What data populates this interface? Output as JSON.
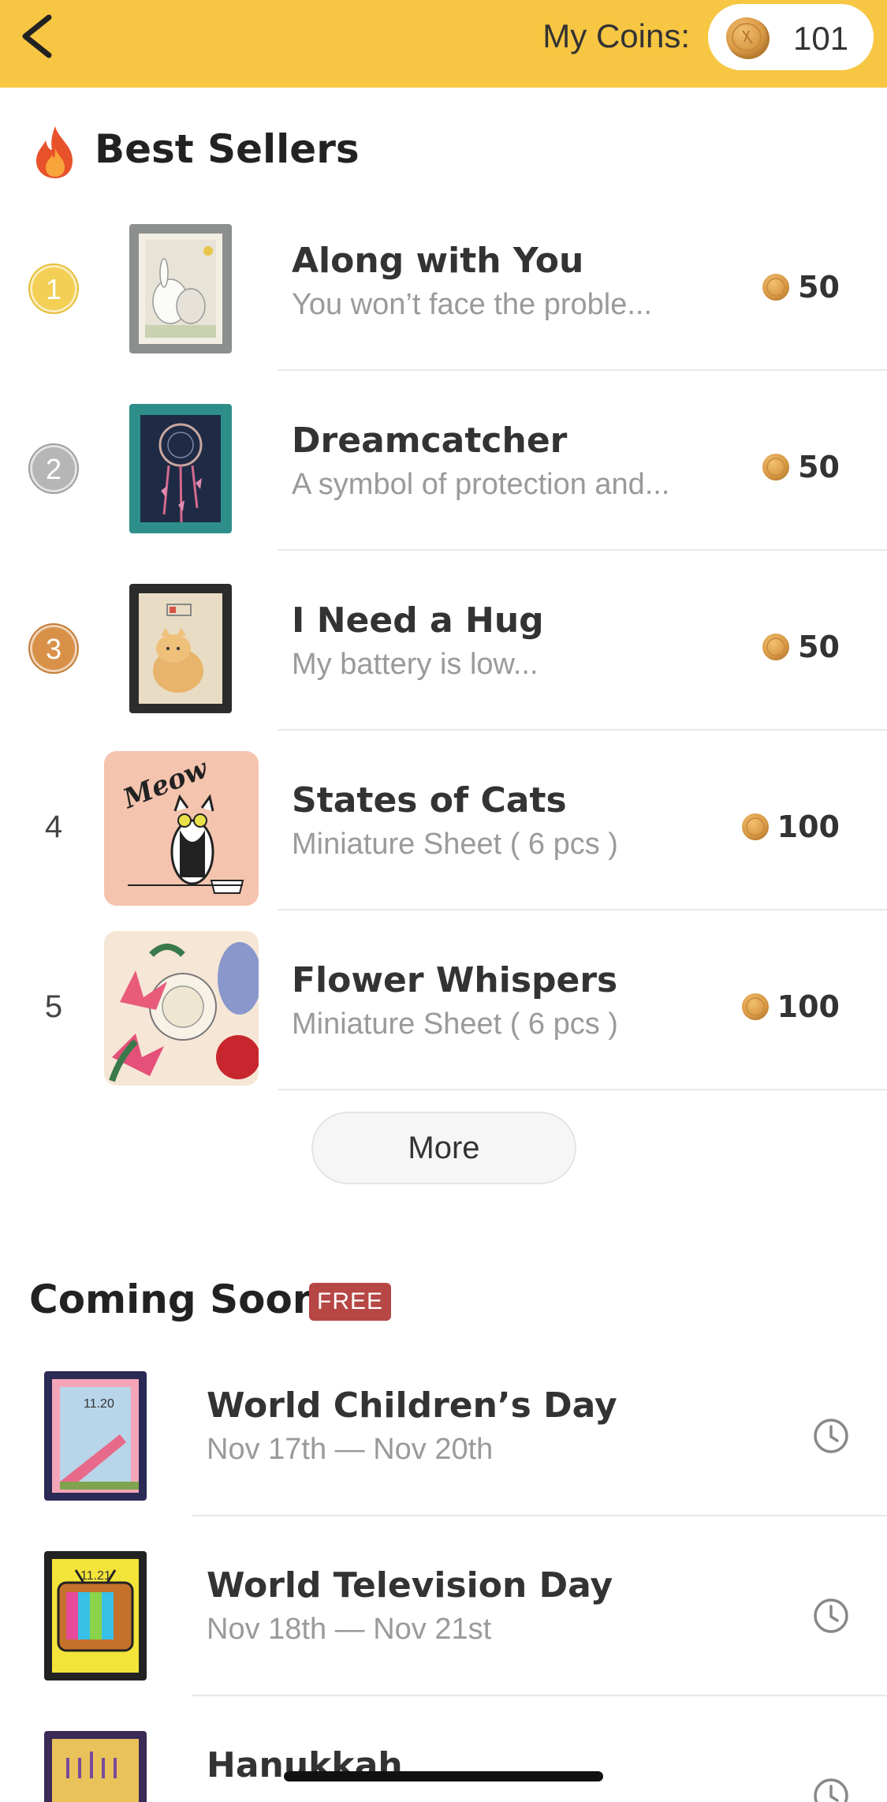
{
  "header": {
    "back_icon": "chevron-left-icon",
    "coins_label": "My Coins:",
    "coins_value": "101",
    "accent_color": "#F7C642"
  },
  "best_sellers": {
    "title": "Best Sellers",
    "icon": "fire-icon",
    "items": [
      {
        "rank": "1",
        "title": "Along with You",
        "subtitle": "You won’t face the proble...",
        "price": "50"
      },
      {
        "rank": "2",
        "title": "Dreamcatcher",
        "subtitle": "A symbol of protection and...",
        "price": "50"
      },
      {
        "rank": "3",
        "title": "I Need a Hug",
        "subtitle": "My battery is low...",
        "price": "50"
      },
      {
        "rank": "4",
        "title": "States of Cats",
        "subtitle": "Miniature Sheet ( 6 pcs )",
        "price": "100",
        "art_text": "Meow"
      },
      {
        "rank": "5",
        "title": "Flower Whispers",
        "subtitle": "Miniature Sheet ( 6 pcs )",
        "price": "100"
      }
    ],
    "more_label": "More"
  },
  "coming_soon": {
    "title": "Coming Soon",
    "badge": "FREE",
    "badge_color": "#B64745",
    "items": [
      {
        "title": "World Children’s Day",
        "date": "Nov 17th — Nov 20th",
        "stamp_text": "11.20",
        "icon": "clock-icon"
      },
      {
        "title": "World Television Day",
        "date": "Nov 18th — Nov 21st",
        "stamp_text": "11.21",
        "icon": "clock-icon"
      },
      {
        "title": "Hanukkah",
        "date": "",
        "icon": "clock-icon"
      }
    ]
  }
}
